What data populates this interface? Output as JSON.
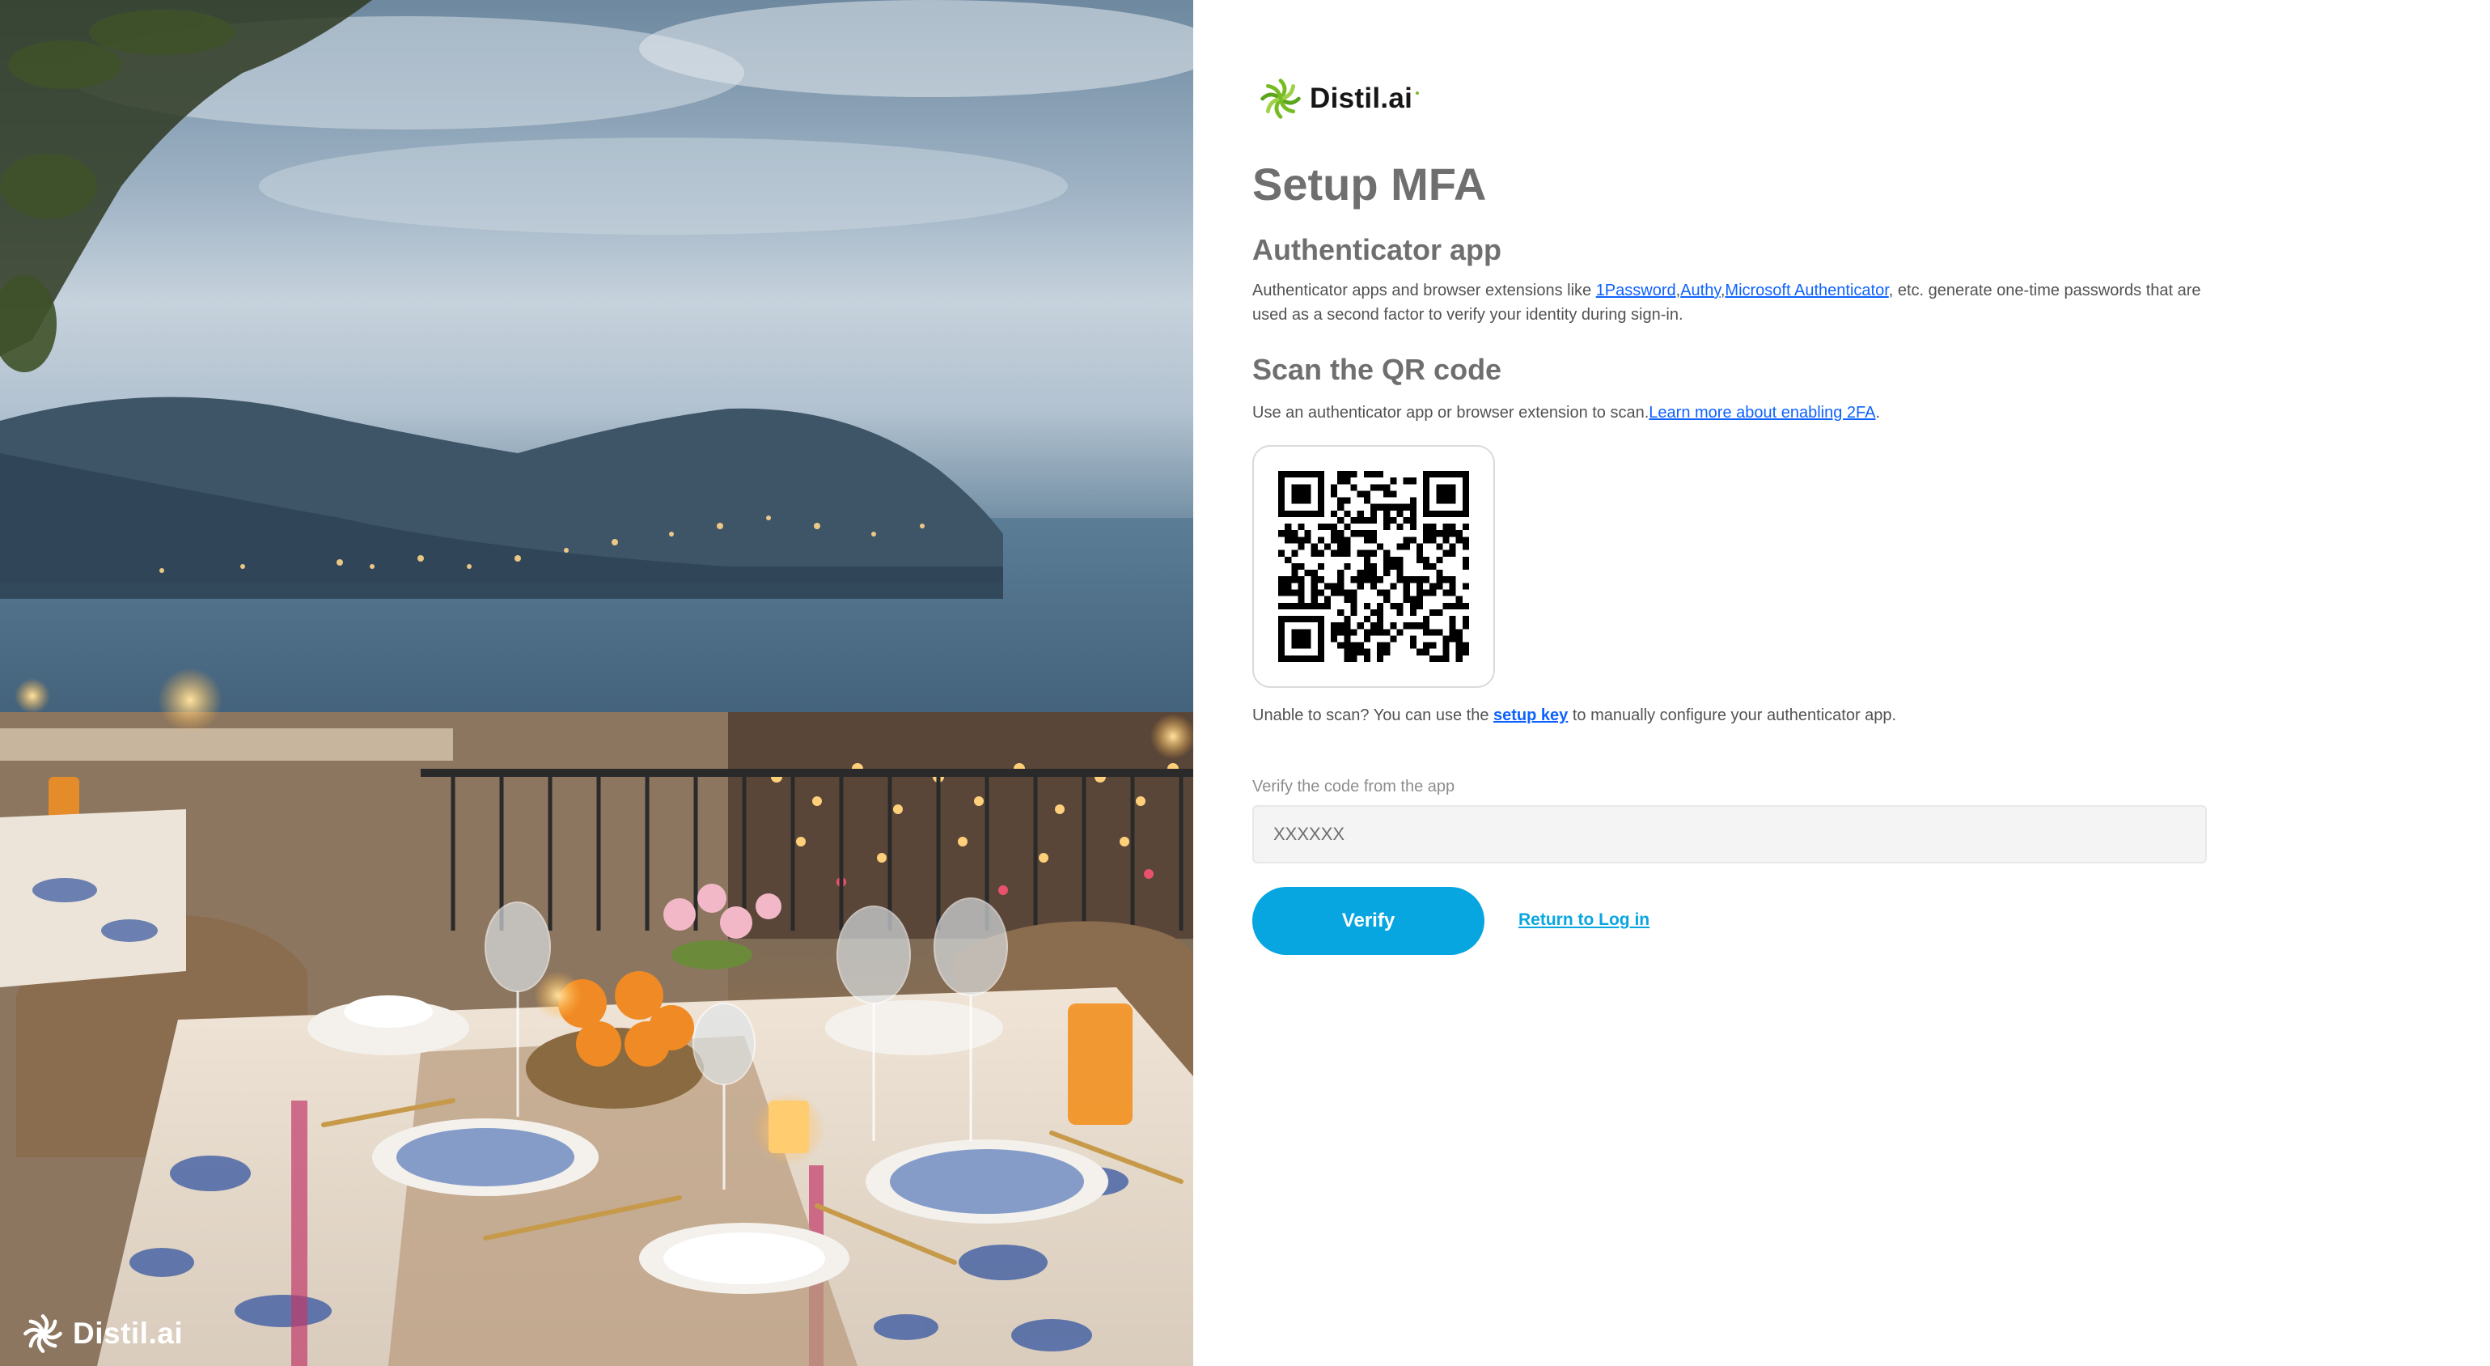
{
  "brand": {
    "name": "Distil.ai",
    "accent_color": "#76bc21",
    "icon": "distil-swirl-logo-icon"
  },
  "hero": {
    "logo_text": "Distil.ai",
    "description_icon": "coastal-terrace-dinner-photo"
  },
  "page": {
    "title": "Setup MFA"
  },
  "authenticator": {
    "heading": "Authenticator app",
    "desc_prefix": "Authenticator apps and browser extensions like ",
    "apps": [
      "1Password",
      "Authy",
      "Microsoft Authenticator"
    ],
    "desc_suffix": ", etc. generate one-time passwords that are used as a second factor to verify your identity during sign-in."
  },
  "qr": {
    "heading": "Scan the QR code",
    "instruction": "Use an authenticator app or browser extension to scan.",
    "learn_more": "Learn more about enabling 2FA",
    "instruction_end": ".",
    "unable_prefix": "Unable to scan? You can use the ",
    "setup_key": "setup key",
    "unable_suffix": " to manually configure your authenticator app."
  },
  "verify": {
    "label": "Verify the code from the app",
    "placeholder": "XXXXXX",
    "button": "Verify",
    "return_link": "Return to Log in"
  },
  "colors": {
    "primary_button": "#08a6e0",
    "link": "#0f62fe",
    "heading": "#6f6f6f"
  }
}
